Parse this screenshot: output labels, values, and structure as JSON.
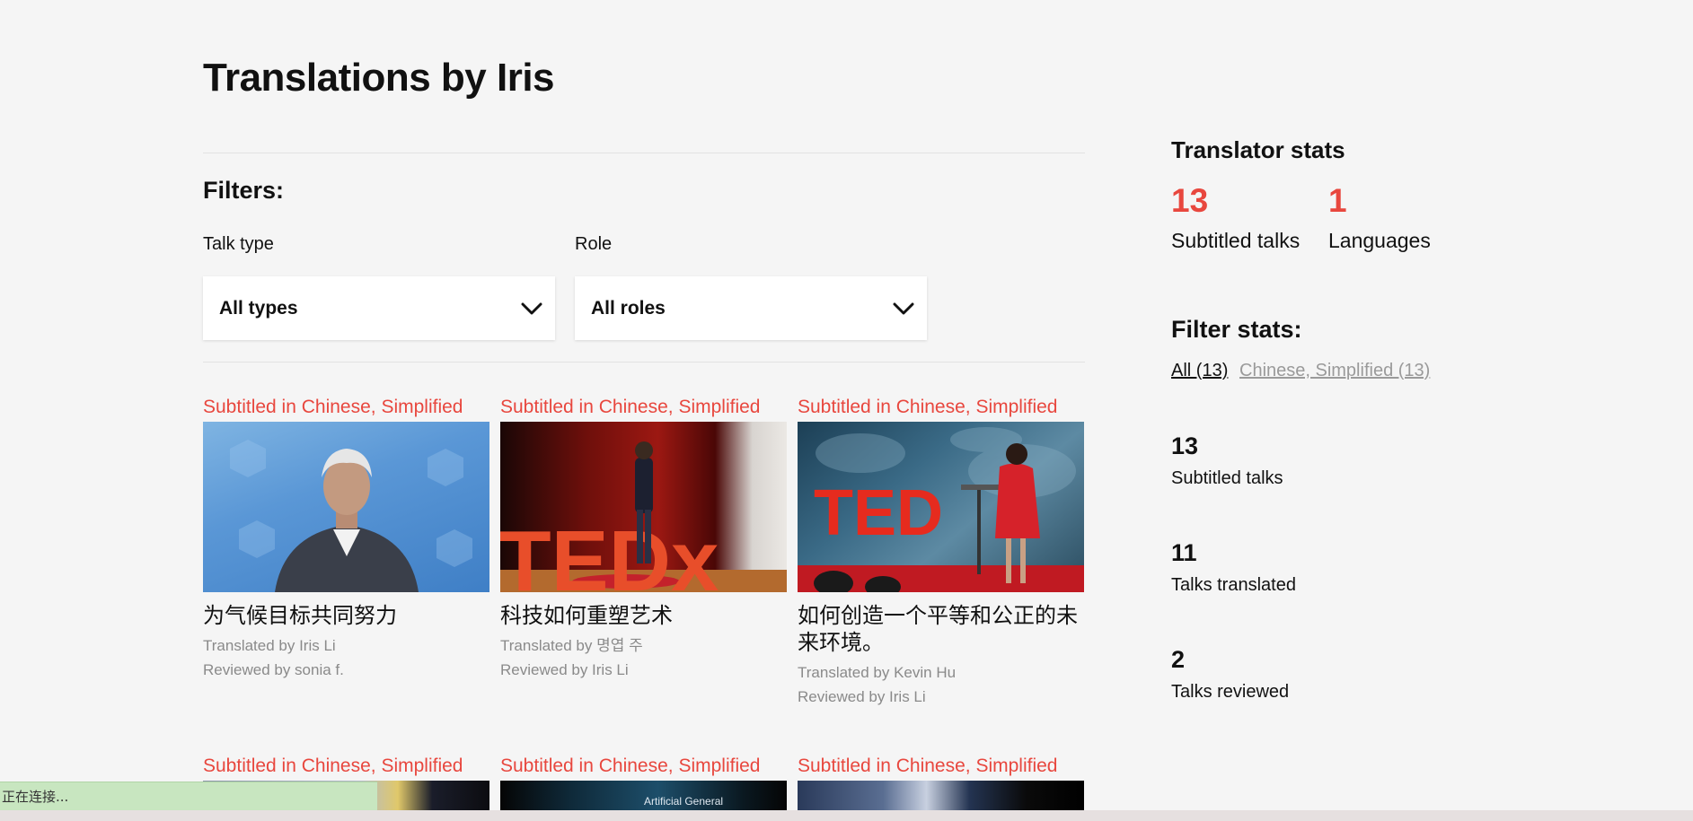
{
  "page": {
    "title": "Translations by Iris"
  },
  "filters": {
    "heading": "Filters:",
    "talk_type": {
      "label": "Talk type",
      "value": "All types"
    },
    "role": {
      "label": "Role",
      "value": "All roles"
    }
  },
  "cards": [
    {
      "language": "Subtitled in Chinese, Simplified",
      "title": "为气候目标共同努力",
      "translated_by": "Translated by Iris Li",
      "reviewed_by": "Reviewed by sonia f."
    },
    {
      "language": "Subtitled in Chinese, Simplified",
      "title": "科技如何重塑艺术",
      "translated_by": "Translated by 명엽 주",
      "reviewed_by": "Reviewed by Iris Li"
    },
    {
      "language": "Subtitled in Chinese, Simplified",
      "title": "如何创造一个平等和公正的未来环境。",
      "translated_by": "Translated by Kevin Hu",
      "reviewed_by": "Reviewed by Iris Li"
    },
    {
      "language": "Subtitled in Chinese, Simplified"
    },
    {
      "language": "Subtitled in Chinese, Simplified",
      "thumb_text": "Artificial General"
    },
    {
      "language": "Subtitled in Chinese, Simplified"
    }
  ],
  "thumb_logos": {
    "card2": "TEDx",
    "card3": "TED"
  },
  "translator_stats": {
    "heading": "Translator stats",
    "subtitled_talks": {
      "value": "13",
      "label": "Subtitled talks"
    },
    "languages": {
      "value": "1",
      "label": "Languages"
    }
  },
  "filter_stats": {
    "heading": "Filter stats:",
    "links": [
      "All (13)",
      "Chinese, Simplified (13)"
    ],
    "stats": [
      {
        "value": "13",
        "label": "Subtitled talks"
      },
      {
        "value": "11",
        "label": "Talks translated"
      },
      {
        "value": "2",
        "label": "Talks reviewed"
      }
    ]
  },
  "status": {
    "text": "正在连接..."
  },
  "colors": {
    "accent": "#e8473e",
    "background": "#f5f5f5"
  }
}
